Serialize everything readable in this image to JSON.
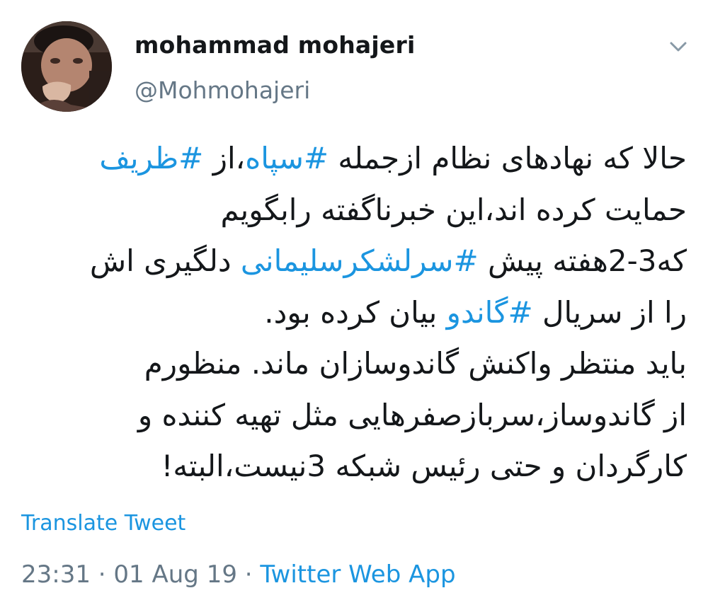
{
  "tweet": {
    "author": {
      "display_name": "mohammad mohajeri",
      "handle": "@Mohmohajeri",
      "avatar_icon": "profile-photo"
    },
    "menu_icon": "chevron-down-icon",
    "body_lines": [
      [
        {
          "text": "حالا که نهادهای نظام ازجمله ",
          "hashtag": false
        },
        {
          "text": "#سپاه",
          "hashtag": true
        },
        {
          "text": "،از ",
          "hashtag": false
        },
        {
          "text": "#ظریف",
          "hashtag": true
        }
      ],
      [
        {
          "text": "حمایت کرده اند،این خبرناگفته رابگویم",
          "hashtag": false
        }
      ],
      [
        {
          "text": "که3-2هفته پیش ",
          "hashtag": false
        },
        {
          "text": "#سرلشکرسلیمانی",
          "hashtag": true
        },
        {
          "text": " دلگیری اش",
          "hashtag": false
        }
      ],
      [
        {
          "text": "را از سریال ",
          "hashtag": false
        },
        {
          "text": "#گاندو",
          "hashtag": true
        },
        {
          "text": " بیان کرده بود.",
          "hashtag": false
        }
      ],
      [
        {
          "text": "باید منتظر واکنش گاندوسازان ماند. منظورم",
          "hashtag": false
        }
      ],
      [
        {
          "text": "از گاندوساز،سربازصفرهایی مثل تهیه کننده و",
          "hashtag": false
        }
      ],
      [
        {
          "text": "کارگردان و حتی رئیس شبکه 3نیست،البته!",
          "hashtag": false
        }
      ]
    ],
    "translate_label": "Translate Tweet",
    "time": "23:31",
    "separator": " · ",
    "date": "01 Aug 19",
    "source": "Twitter Web App"
  },
  "colors": {
    "text": "#14171a",
    "secondary": "#657786",
    "link": "#1b95e0",
    "background": "#ffffff"
  }
}
